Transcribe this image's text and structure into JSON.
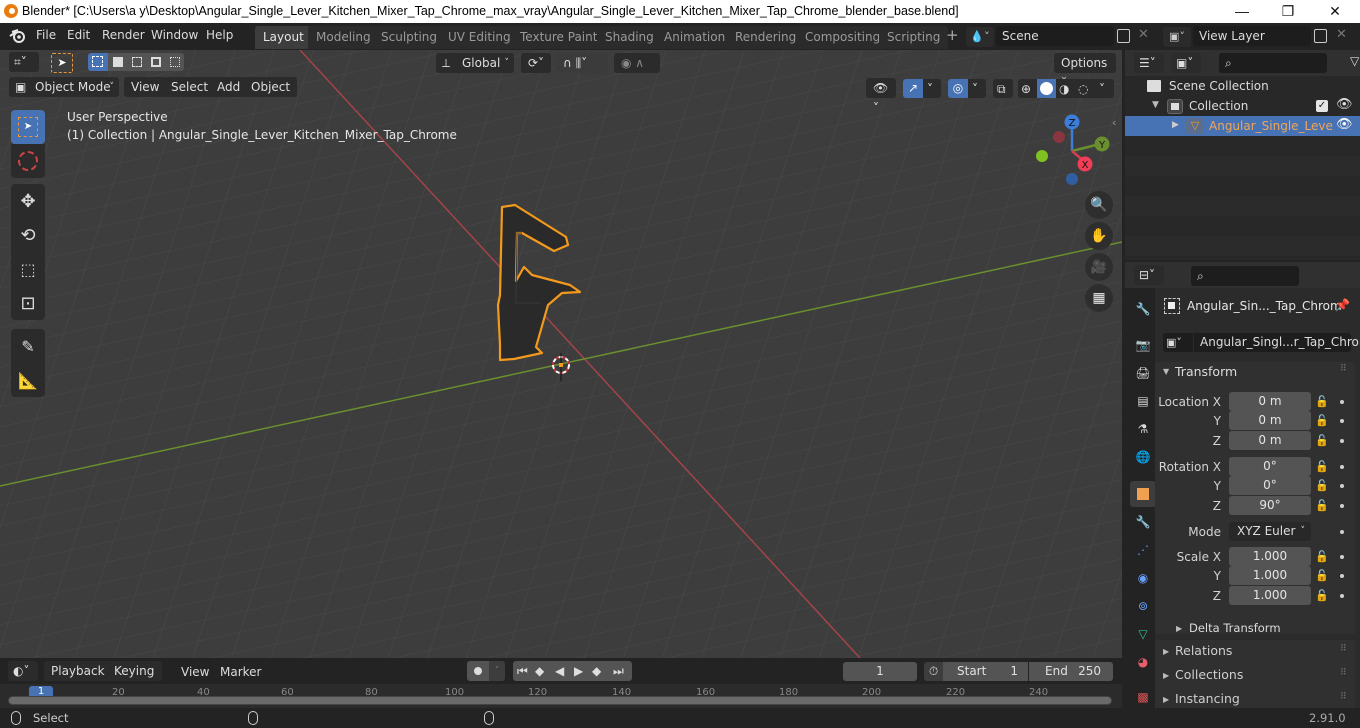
{
  "window": {
    "title": "Blender* [C:\\Users\\a y\\Desktop\\Angular_Single_Lever_Kitchen_Mixer_Tap_Chrome_max_vray\\Angular_Single_Lever_Kitchen_Mixer_Tap_Chrome_blender_base.blend]",
    "minimize": "—",
    "maximize": "❐",
    "close": "✕"
  },
  "menu": [
    "File",
    "Edit",
    "Render",
    "Window",
    "Help"
  ],
  "workspaces": [
    {
      "label": "Layout",
      "active": true
    },
    {
      "label": "Modeling"
    },
    {
      "label": "Sculpting"
    },
    {
      "label": "UV Editing"
    },
    {
      "label": "Texture Paint"
    },
    {
      "label": "Shading"
    },
    {
      "label": "Animation"
    },
    {
      "label": "Rendering"
    },
    {
      "label": "Compositing"
    },
    {
      "label": "Scripting"
    }
  ],
  "add_workspace": "+",
  "scene": {
    "value": "Scene"
  },
  "view_layer": {
    "value": "View Layer"
  },
  "viewport": {
    "transform_orientation": "Global",
    "options_label": "Options",
    "mode": "Object Mode",
    "header_menus": [
      "View",
      "Select",
      "Add",
      "Object"
    ],
    "overlay_line1": "User Perspective",
    "overlay_line2": "(1) Collection | Angular_Single_Lever_Kitchen_Mixer_Tap_Chrome",
    "gizmo": {
      "x": "X",
      "y": "Y",
      "z": "Z"
    }
  },
  "outliner": {
    "items": [
      {
        "label": "Scene Collection"
      },
      {
        "label": "Collection"
      },
      {
        "label": "Angular_Single_Leve"
      }
    ]
  },
  "properties": {
    "object_name": "Angular_Sin..._Tap_Chrom",
    "data_name": "Angular_Singl...r_Tap_Chrome",
    "transform_title": "Transform",
    "location": {
      "label": "Location X",
      "x": "0 m",
      "y": "0 m",
      "z": "0 m"
    },
    "rotation": {
      "label": "Rotation X",
      "x": "0°",
      "y": "0°",
      "z": "90°"
    },
    "mode_label": "Mode",
    "mode_value": "XYZ Euler",
    "scale": {
      "label": "Scale X",
      "x": "1.000",
      "y": "1.000",
      "z": "1.000"
    },
    "axis_y": "Y",
    "axis_z": "Z",
    "delta_transform": "Delta Transform",
    "relations": "Relations",
    "collections": "Collections",
    "instancing": "Instancing"
  },
  "timeline": {
    "menus": [
      "Playback",
      "Keying",
      "View",
      "Marker"
    ],
    "current_frame": "1",
    "start_label": "Start",
    "start": "1",
    "end_label": "End",
    "end": "250",
    "ticks": [
      "1",
      "20",
      "40",
      "60",
      "80",
      "100",
      "120",
      "140",
      "160",
      "180",
      "200",
      "220",
      "240"
    ]
  },
  "statusbar": {
    "select": "Select",
    "version": "2.91.0"
  }
}
